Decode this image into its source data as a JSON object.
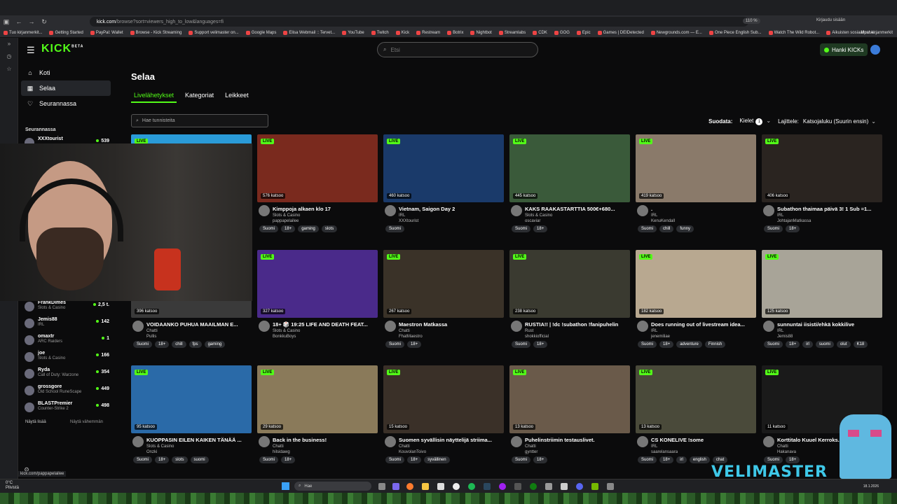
{
  "browser": {
    "url_host": "kick.com",
    "url_path": "/browse?sort=viewers_high_to_low&languages=fi",
    "zoom": "110 %",
    "signin": "Kirjaudu sisään",
    "bookmarks": [
      "Tuo kirjanmerkit...",
      "Getting Started",
      "PayPal: Wallet",
      "Browse - Kick Streaming",
      "Support velimaster on...",
      "Google Maps",
      "Elisa Webmail :: Tervet...",
      "YouTube",
      "Twitch",
      "Kick",
      "Restream",
      "Botrix",
      "Nightbot",
      "Streamlabs",
      "CDK",
      "GOG",
      "Epic",
      "Games | DEIDetected",
      "Newgrounds.com — E...",
      "One Piece English Sub...",
      "Watch The Wild Robot...",
      "Aikuisten sosiaalipalve..."
    ],
    "bookmarks_more": "Muut kirjanmerkit",
    "status_url": "kick.com/pappapelailee"
  },
  "header": {
    "logo": "KICK",
    "logo_sup": "BETA",
    "search_placeholder": "Etsi",
    "kicks_button": "Hanki KICKs"
  },
  "sidebar": {
    "nav": [
      {
        "label": "Koti",
        "icon": "home-icon"
      },
      {
        "label": "Selaa",
        "icon": "browse-icon"
      },
      {
        "label": "Seurannassa",
        "icon": "heart-icon"
      }
    ],
    "following_title": "Seurannassa",
    "following": [
      {
        "name": "XXXtourist",
        "category": "",
        "count": "539"
      },
      {
        "name": "FrankDimes",
        "category": "Slots & Casino",
        "count": "2,5 t."
      },
      {
        "name": "Jemis88",
        "category": "IRL",
        "count": "142"
      },
      {
        "name": "omaxtr",
        "category": "ARC Raiders",
        "count": "1"
      },
      {
        "name": "joe",
        "category": "Slots & Casino",
        "count": "166"
      },
      {
        "name": "Ryda",
        "category": "Call of Duty: Warzone",
        "count": "354"
      },
      {
        "name": "grossgore",
        "category": "Old School RuneScape",
        "count": "449"
      },
      {
        "name": "BLASTPremier",
        "category": "Counter-Strike 2",
        "count": "498"
      }
    ],
    "show_more": "Näytä lisää",
    "show_less": "Näytä vähemmän"
  },
  "main": {
    "title": "Selaa",
    "tabs": [
      "Livelähetykset",
      "Kategoriat",
      "Leikkeet"
    ],
    "tag_search_placeholder": "Hae tunnisteita",
    "filter_label": "Suodata:",
    "languages_label": "Kielet",
    "languages_count": "1",
    "sort_label": "Lajittele:",
    "sort_value": "Katsojaluku (Suurin ensin)"
  },
  "streams": [
    {
      "live": "LIVE",
      "viewers": "",
      "title": "",
      "category": "",
      "user": "",
      "tags": [],
      "color": "#2a9bd8"
    },
    {
      "live": "LIVE",
      "viewers": "576 katsoo",
      "title": "Kimppoja alkaen klo 17",
      "category": "Slots & Casino",
      "user": "pappapelailee",
      "tags": [
        "Suomi",
        "18+",
        "gaming",
        "slots"
      ],
      "color": "#7a2a1e"
    },
    {
      "live": "LIVE",
      "viewers": "460 katsoo",
      "title": "Vietnam, Saigon Day 2",
      "category": "IRL",
      "user": "XXXtourist",
      "tags": [
        "Suomi"
      ],
      "color": "#1a3a6a"
    },
    {
      "live": "LIVE",
      "viewers": "445 katsoo",
      "title": "KAKS RAAKASTARTTIA 500€+680...",
      "category": "Slots & Casino",
      "user": "oscaviar",
      "tags": [
        "Suomi",
        "18+"
      ],
      "color": "#3a5a3a"
    },
    {
      "live": "LIVE",
      "viewers": "419 katsoo",
      "title": ".",
      "category": "IRL",
      "user": "KenuKendall",
      "tags": [
        "Suomi",
        "chill",
        "funny"
      ],
      "color": "#8a7a6a"
    },
    {
      "live": "LIVE",
      "viewers": "406 katsoo",
      "title": "Subathon thaimaa päivä 3! 1 Sub =1...",
      "category": "IRL",
      "user": "JohtajanMatkassa",
      "tags": [
        "Suomi",
        "18+"
      ],
      "color": "#2a2420"
    },
    {
      "live": "LIVE",
      "viewers": "396 katsoo",
      "title": "VOIDAANKO PUHUA MAAILMAN E...",
      "category": "Chatti",
      "user": "Pullis",
      "tags": [
        "Suomi",
        "18+",
        "chill",
        "fps",
        "gaming"
      ],
      "color": "#3a3a3a"
    },
    {
      "live": "LIVE",
      "viewers": "327 katsoo",
      "title": "18+ 🎲 19:25 LIFE AND DEATH FEAT...",
      "category": "Slots & Casino",
      "user": "BonkkuBoys",
      "tags": [],
      "color": "#4a2a8a"
    },
    {
      "live": "LIVE",
      "viewers": "267 katsoo",
      "title": "Maestron Matkassa",
      "category": "Chatti",
      "user": "FhatMaestro",
      "tags": [
        "Suomi",
        "18+"
      ],
      "color": "#3a3228"
    },
    {
      "live": "LIVE",
      "viewers": "238 katsoo",
      "title": "RUSTIA!! | !dc !subathon !fanipuhelin",
      "category": "Rust",
      "user": "shokkiofficial",
      "tags": [
        "Suomi",
        "18+"
      ],
      "color": "#3a3a30"
    },
    {
      "live": "LIVE",
      "viewers": "182 katsoo",
      "title": "Does running out of livestream idea...",
      "category": "IRL",
      "user": "jenemiliae",
      "tags": [
        "Suomi",
        "18+",
        "adventure",
        "Finnish"
      ],
      "color": "#b8a890"
    },
    {
      "live": "LIVE",
      "viewers": "125 katsoo",
      "title": "sunnuntai iisisti/ehkä kokkilive",
      "category": "IRL",
      "user": "Jemis88",
      "tags": [
        "Suomi",
        "18+",
        "irl",
        "suomi",
        "olut",
        "K18"
      ],
      "color": "#a8a498"
    },
    {
      "live": "LIVE",
      "viewers": "95 katsoo",
      "title": "KUOPPASIN EILEN KAIKEN TÄNÄÄ ...",
      "category": "Slots & Casino",
      "user": "Onzki",
      "tags": [
        "Suomi",
        "18+",
        "slots",
        "suomi"
      ],
      "color": "#2a6aa8"
    },
    {
      "live": "LIVE",
      "viewers": "29 katsoo",
      "title": "Back in the business!",
      "category": "Chatti",
      "user": "hilsidawg",
      "tags": [
        "Suomi",
        "18+"
      ],
      "color": "#8a7a5a"
    },
    {
      "live": "LIVE",
      "viewers": "15 katsoo",
      "title": "Suomen syvällisin näyttelijä striima...",
      "category": "Chatti",
      "user": "KouvolanToivo",
      "tags": [
        "Suomi",
        "18+",
        "syvällinen"
      ],
      "color": "#3a3028"
    },
    {
      "live": "LIVE",
      "viewers": "13 katsoo",
      "title": "Puhelinstriimin testauslivet.",
      "category": "Chatti",
      "user": "gyntter",
      "tags": [
        "Suomi",
        "18+"
      ],
      "color": "#6a5a4a"
    },
    {
      "live": "LIVE",
      "viewers": "13 katsoo",
      "title": "CS KONELIVE !some",
      "category": "IRL",
      "user": "saarelansaara",
      "tags": [
        "Suomi",
        "18+",
        "irl",
        "english",
        "chat"
      ],
      "color": "#4a4a3a"
    },
    {
      "live": "LIVE",
      "viewers": "11 katsoo",
      "title": "Korttitalo Kuuel Kerroks...",
      "category": "Chatti",
      "user": "Hakanava",
      "tags": [
        "Suomi",
        "18+"
      ],
      "color": "#1a1a1a"
    }
  ],
  "taskbar": {
    "weather_temp": "0°C",
    "weather_desc": "Pilvistä",
    "search": "Hae",
    "date": "18.1.2026"
  },
  "overlay": {
    "watermark": "VELIMASTER"
  }
}
